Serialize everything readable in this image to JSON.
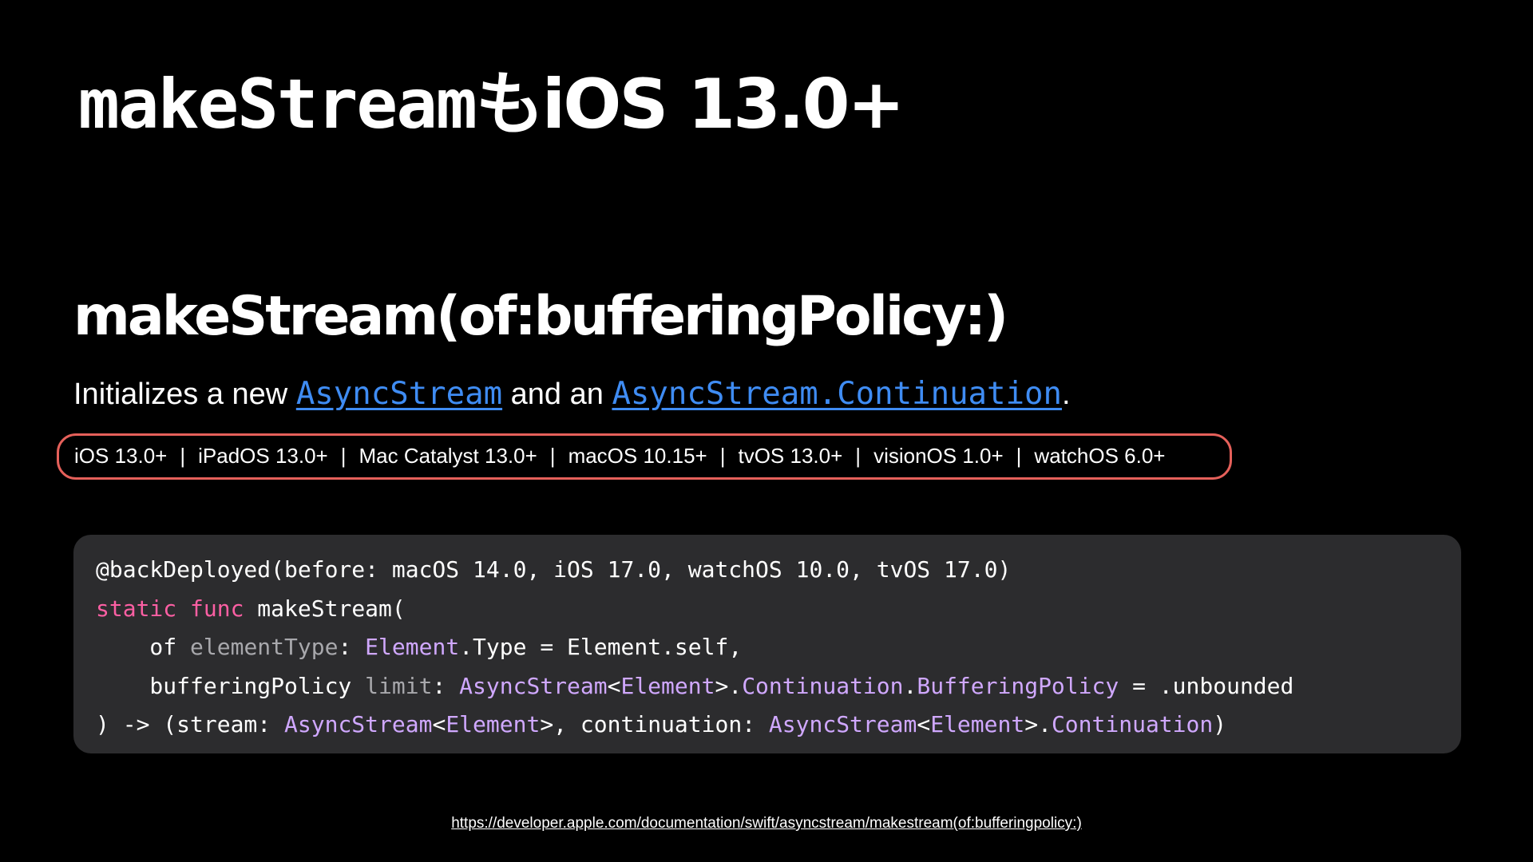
{
  "slide": {
    "title_mono": "makeStream",
    "title_rest": "もiOS 13.0+"
  },
  "doc": {
    "title": "makeStream(of:bufferingPolicy:)",
    "abstract_prefix": "Initializes a new ",
    "abstract_link1": "AsyncStream",
    "abstract_middle": " and an ",
    "abstract_link2": "AsyncStream.Continuation",
    "abstract_suffix": ".",
    "link_color": "#3f8cf3",
    "platforms": [
      "iOS 13.0+",
      "iPadOS 13.0+",
      "Mac Catalyst 13.0+",
      "macOS 10.15+",
      "tvOS 13.0+",
      "visionOS 1.0+",
      "watchOS 6.0+"
    ],
    "platform_separator": "|",
    "highlight_color": "#e5605a"
  },
  "code": {
    "background": "#2c2c2e",
    "keyword_color": "#fc5fa3",
    "type_color": "#d0a8ff",
    "line1": "@backDeployed(before: macOS 14.0, iOS 17.0, watchOS 10.0, tvOS 17.0)",
    "line2_kw1": "static",
    "line2_kw2": "func",
    "line2_rest": " makeStream(",
    "line3_indent": "    of ",
    "line3_param": "elementType",
    "line3_colon": ": ",
    "line3_type": "Element",
    "line3_rest": ".Type = Element.self,",
    "line4_indent": "    bufferingPolicy ",
    "line4_param": "limit",
    "line4_colon": ": ",
    "line4_t1": "AsyncStream",
    "line4_lt": "<",
    "line4_t2": "Element",
    "line4_gt": ">.",
    "line4_t3": "Continuation",
    "line4_dot": ".",
    "line4_t4": "BufferingPolicy",
    "line4_rest": " = .unbounded",
    "line5_a": ") -> (stream: ",
    "line5_t1": "AsyncStream",
    "line5_lt": "<",
    "line5_t2": "Element",
    "line5_b": ">, continuation: ",
    "line5_t3": "AsyncStream",
    "line5_lt2": "<",
    "line5_t4": "Element",
    "line5_gt2": ">.",
    "line5_t5": "Continuation",
    "line5_end": ")"
  },
  "footer": {
    "url": "https://developer.apple.com/documentation/swift/asyncstream/makestream(of:bufferingpolicy:)"
  }
}
